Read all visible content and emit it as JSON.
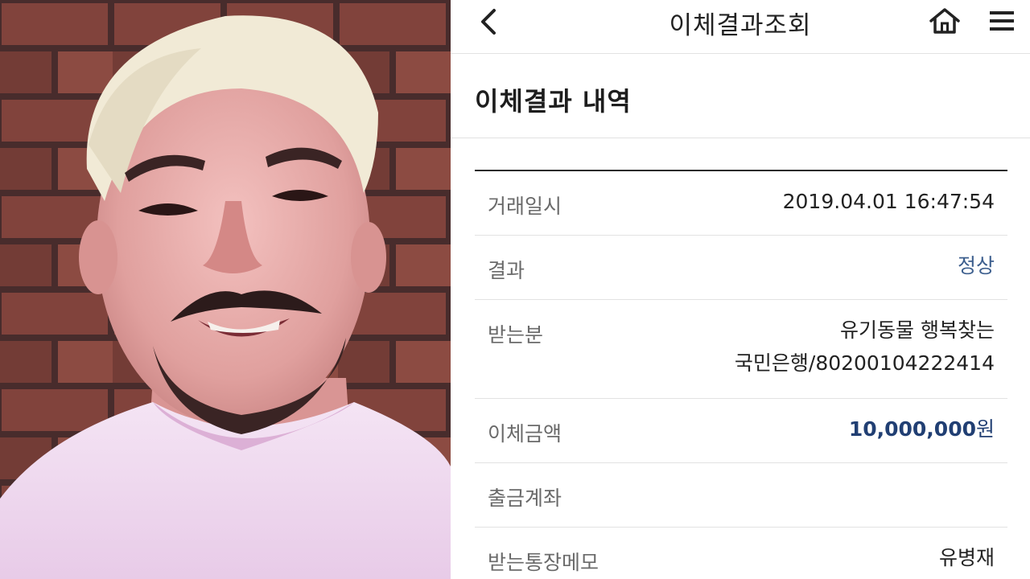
{
  "header": {
    "title": "이체결과조회",
    "back_icon": "chevron-left-icon",
    "home_icon": "home-icon",
    "menu_icon": "hamburger-menu-icon"
  },
  "section": {
    "title": "이체결과 내역"
  },
  "details": {
    "datetime": {
      "label": "거래일시",
      "value": "2019.04.01 16:47:54"
    },
    "result": {
      "label": "결과",
      "value": "정상"
    },
    "recipient": {
      "label": "받는분",
      "name": "유기동물 행복찾는",
      "account": "국민은행/80200104222414"
    },
    "amount": {
      "label": "이체금액",
      "value": "10,000,000",
      "unit": "원"
    },
    "source_account": {
      "label": "출금계좌",
      "value": ""
    },
    "memo": {
      "label": "받는통장메모",
      "value": "유병재"
    }
  },
  "colors": {
    "status": "#3d5f8e",
    "amount": "#213f73",
    "divider": "#e2e2e2"
  }
}
